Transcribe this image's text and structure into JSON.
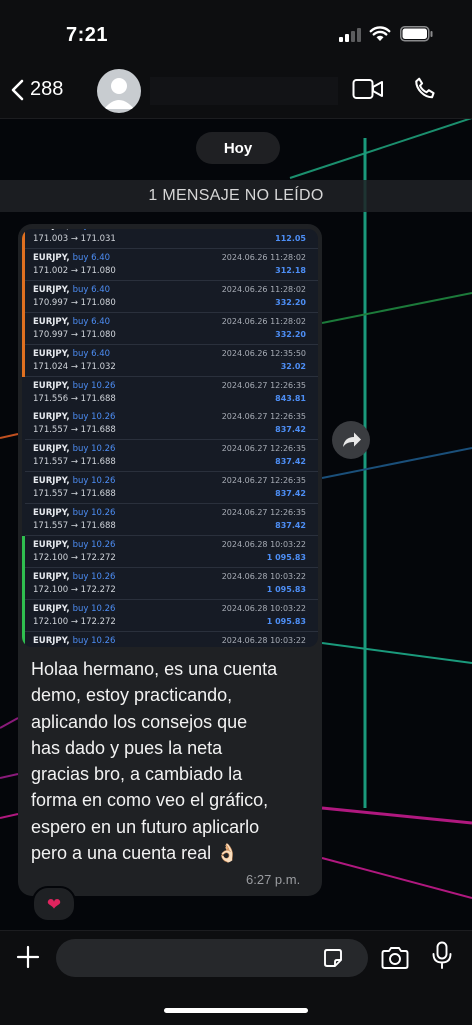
{
  "status": {
    "time": "7:21"
  },
  "header": {
    "back_count": "288",
    "contact_name": ""
  },
  "chat": {
    "date_label": "Hoy",
    "unread_label": "1 MENSAJE NO LEÍDO",
    "trades": [
      {
        "pair": "EURJPY,",
        "side": "buy 6.40",
        "prices": "171.003 → 171.031",
        "date": "2024.06.26 11:28:02",
        "profit": "112.05",
        "accent": "#e07020"
      },
      {
        "pair": "EURJPY,",
        "side": "buy 6.40",
        "prices": "171.002 → 171.080",
        "date": "2024.06.26 11:28:02",
        "profit": "312.18",
        "accent": "#e07020"
      },
      {
        "pair": "EURJPY,",
        "side": "buy 6.40",
        "prices": "170.997 → 171.080",
        "date": "2024.06.26 11:28:02",
        "profit": "332.20",
        "accent": "#e07020"
      },
      {
        "pair": "EURJPY,",
        "side": "buy 6.40",
        "prices": "170.997 → 171.080",
        "date": "2024.06.26 11:28:02",
        "profit": "332.20",
        "accent": "#e07020"
      },
      {
        "pair": "EURJPY,",
        "side": "buy 6.40",
        "prices": "171.024 → 171.032",
        "date": "2024.06.26 12:35:50",
        "profit": "32.02",
        "accent": "#e07020"
      },
      {
        "pair": "EURJPY,",
        "side": "buy 10.26",
        "prices": "171.556 → 171.688",
        "date": "2024.06.27 12:26:35",
        "profit": "843.81",
        "accent": "#161b25"
      },
      {
        "pair": "EURJPY,",
        "side": "buy 10.26",
        "prices": "171.557 → 171.688",
        "date": "2024.06.27 12:26:35",
        "profit": "837.42",
        "accent": "#161b25"
      },
      {
        "pair": "EURJPY,",
        "side": "buy 10.26",
        "prices": "171.557 → 171.688",
        "date": "2024.06.27 12:26:35",
        "profit": "837.42",
        "accent": "#161b25"
      },
      {
        "pair": "EURJPY,",
        "side": "buy 10.26",
        "prices": "171.557 → 171.688",
        "date": "2024.06.27 12:26:35",
        "profit": "837.42",
        "accent": "#161b25"
      },
      {
        "pair": "EURJPY,",
        "side": "buy 10.26",
        "prices": "171.557 → 171.688",
        "date": "2024.06.27 12:26:35",
        "profit": "837.42",
        "accent": "#161b25"
      },
      {
        "pair": "EURJPY,",
        "side": "buy 10.26",
        "prices": "172.100 → 172.272",
        "date": "2024.06.28 10:03:22",
        "profit": "1 095.83",
        "accent": "#2fbf4f"
      },
      {
        "pair": "EURJPY,",
        "side": "buy 10.26",
        "prices": "172.100 → 172.272",
        "date": "2024.06.28 10:03:22",
        "profit": "1 095.83",
        "accent": "#2fbf4f"
      },
      {
        "pair": "EURJPY,",
        "side": "buy 10.26",
        "prices": "172.100 → 172.272",
        "date": "2024.06.28 10:03:22",
        "profit": "1 095.83",
        "accent": "#2fbf4f"
      },
      {
        "pair": "EURJPY,",
        "side": "buy 10.26",
        "prices": "",
        "date": "2024.06.28 10:03:22",
        "profit": "",
        "accent": "#2fbf4f"
      }
    ],
    "message": {
      "lines": [
        "Holaa hermano, es una cuenta",
        "demo, estoy practicando,",
        "aplicando los consejos que",
        "has dado y pues la neta",
        "gracias bro, a cambiado la",
        "forma en como veo el gráfico,",
        "espero en un futuro aplicarlo",
        "pero a una cuenta real 👌🏻"
      ],
      "time": "6:27 p.m.",
      "reaction": "❤"
    }
  },
  "input": {
    "placeholder": ""
  },
  "colors": {
    "background": "#04060a",
    "bubble": "#1f2124",
    "accent_blue": "#4d8ef5",
    "neon_green": "#19c990",
    "neon_magenta": "#c2198a"
  }
}
